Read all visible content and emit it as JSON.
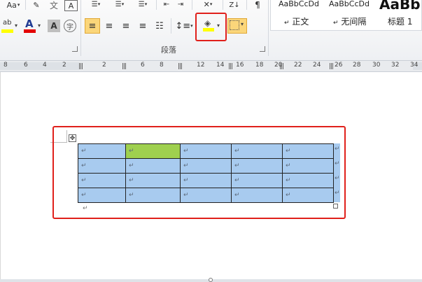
{
  "ribbon": {
    "font": {
      "aa_label": "Aa",
      "phonetic_label": "文",
      "border_char_label": "A",
      "highlight_label": "ab",
      "font_color_label": "A",
      "enclose_label": "字"
    },
    "paragraph": {
      "group_label": "段落"
    },
    "styles": {
      "items": [
        {
          "sample": "AaBbCcDd",
          "label": "正文"
        },
        {
          "sample": "AaBbCcDd",
          "label": "无间隔"
        },
        {
          "sample": "AaBb",
          "label": "标题 1"
        }
      ]
    },
    "colors": {
      "highlight_yellow": "#ffff00",
      "font_red": "#e30000",
      "shading_yellow": "#ffff00",
      "border_button_bg": "#f7d56b",
      "selection_red": "#e0201b"
    }
  },
  "ruler": {
    "numbers": [
      "8",
      "6",
      "4",
      "2",
      "2",
      "6",
      "8",
      "12",
      "14",
      "16",
      "18",
      "20",
      "22",
      "24",
      "26",
      "28",
      "30",
      "32",
      "34"
    ]
  },
  "document": {
    "table": {
      "rows": [
        [
          "↵",
          "↵",
          "↵",
          "↵",
          "↵"
        ],
        [
          "↵",
          "↵",
          "↵",
          "↵",
          "↵"
        ],
        [
          "↵",
          "↵",
          "↵",
          "↵",
          "↵"
        ],
        [
          "↵",
          "↵",
          "↵",
          "↵",
          "↵"
        ]
      ],
      "row_end_marks": [
        "↵",
        "↵",
        "↵",
        "↵"
      ],
      "green_cell": "row 1, column 2",
      "move_handle_icon": "move-icon"
    },
    "paragraph_mark": "↵"
  }
}
